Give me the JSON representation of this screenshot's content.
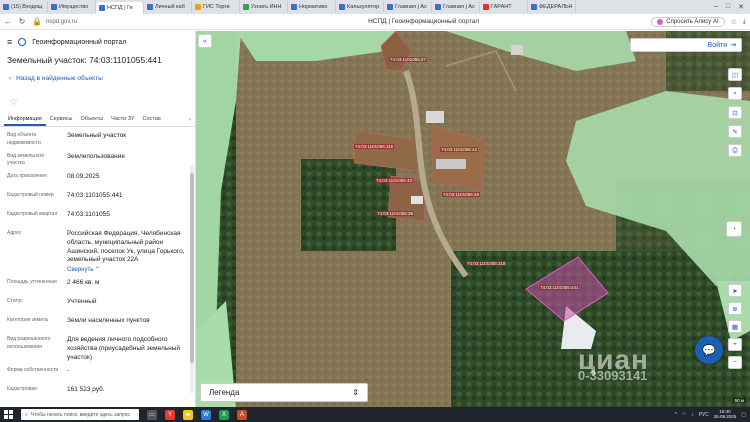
{
  "browser": {
    "tabs": [
      {
        "label": "(15) Входящ",
        "color": "#3b6fd6"
      },
      {
        "label": "Имущество",
        "color": "#3b6fd6"
      },
      {
        "label": "НСПД | Ге",
        "color": "#3b6fd6",
        "active": true
      },
      {
        "label": "Личный каб",
        "color": "#3b6fd6"
      },
      {
        "label": "ГИС Торги",
        "color": "#f0a020"
      },
      {
        "label": "Узнать ИНН",
        "color": "#2aa84a"
      },
      {
        "label": "Нормативн",
        "color": "#3b6fd6"
      },
      {
        "label": "Калькулятор",
        "color": "#3b6fd6"
      },
      {
        "label": "Главная | Ac",
        "color": "#3b6fd6"
      },
      {
        "label": "Главная | Ac",
        "color": "#3b6fd6"
      },
      {
        "label": "ГАРАНТ",
        "color": "#d33"
      },
      {
        "label": "ФЕДЕРАЛЬН",
        "color": "#3b6fd6"
      }
    ],
    "url": "nspd.gov.ru",
    "page_title": "НСПД | Геоинформационный портал",
    "alice_label": "Спросить Алису AI"
  },
  "panel": {
    "portal_title": "Геоинформационный портал",
    "parcel_title": "Земельный участок: 74:03:1101055:441",
    "back_label": "Назад в найденные объекты",
    "tabs": [
      "Информация",
      "Сервисы",
      "Объекты",
      "Части ЗУ",
      "Состав"
    ],
    "rows": [
      {
        "label": "Вид объекта недвижимости",
        "value": "Земельный участок"
      },
      {
        "label": "Вид земельного участка",
        "value": "Землепользование"
      },
      {
        "label": "Дата присвоения",
        "value": "08.09.2025"
      },
      {
        "label": "Кадастровый номер",
        "value": "74:03:1101055:441"
      },
      {
        "label": "Кадастровый квартал",
        "value": "74:03:1101055"
      },
      {
        "label": "Адрес",
        "value": "Российская Федерация, Челябинская область, муниципальный район Ашинский, поселок Ук, улица Горького, земельный участок 22А",
        "link": "Свернуть"
      },
      {
        "label": "Площадь уточненная",
        "value": "2 466 кв. м"
      },
      {
        "label": "Статус",
        "value": "Учтенный"
      },
      {
        "label": "Категория земель",
        "value": "Земли населенных пунктов"
      },
      {
        "label": "Вид разрешенного использования",
        "value": "Для ведения личного подсобного хозяйства (приусадебный земельный участок)"
      },
      {
        "label": "Форма собственности",
        "value": "-"
      },
      {
        "label": "Кадастровая",
        "value": "161 523 руб."
      }
    ]
  },
  "map": {
    "login_label": "Войти",
    "legend_label": "Легенда",
    "watermark": "циан",
    "watermark_id": "0-33093141",
    "scale_text": "50 м"
  },
  "taskbar": {
    "search_placeholder": "Чтобы начать поиск, введите здесь запрос",
    "lang": "РУС",
    "time": "16:40",
    "date": "26.09.2025"
  },
  "colors": {
    "accent": "#1b5fb4",
    "parcel_fill": "#c44ea6",
    "zone_green": "#9ad39f"
  }
}
